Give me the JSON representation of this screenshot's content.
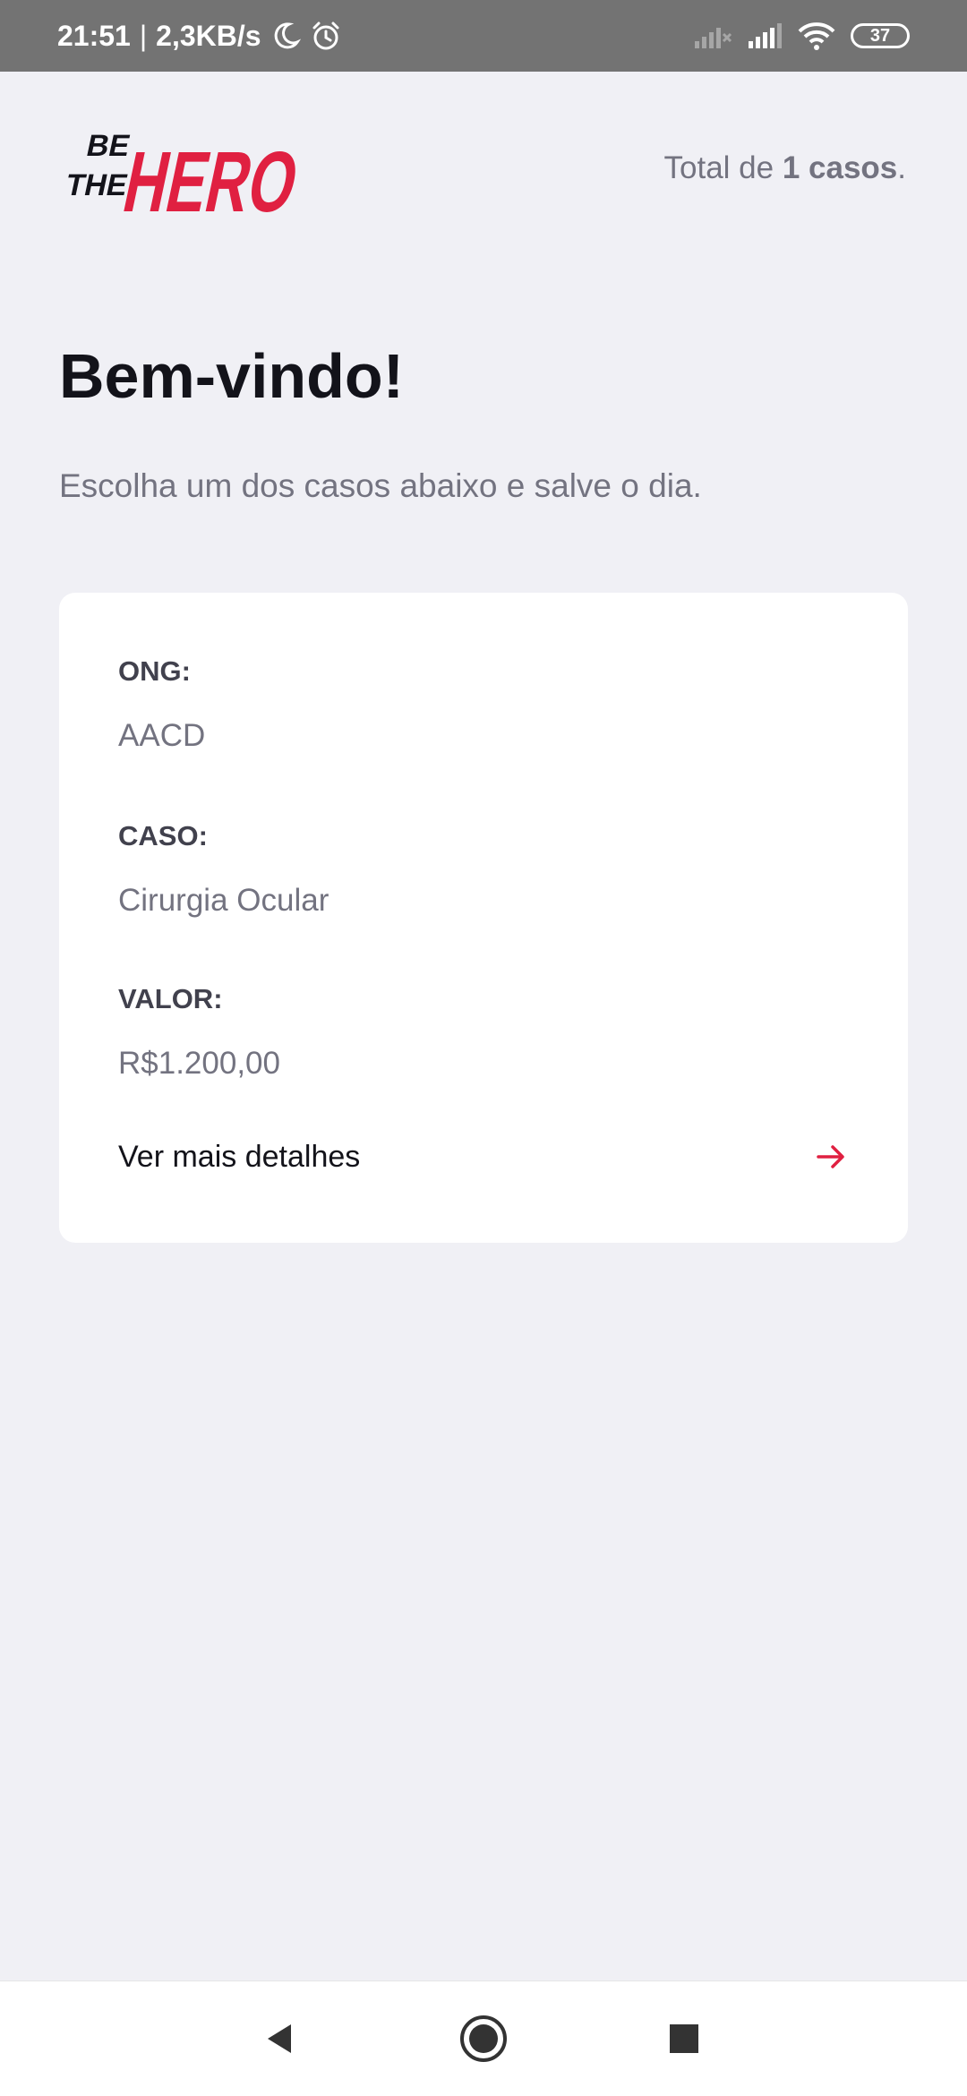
{
  "status_bar": {
    "time": "21:51",
    "separator": "|",
    "net_speed": "2,3KB/s",
    "battery": "37"
  },
  "header": {
    "logo_text": "BE THE HERO",
    "total_prefix": "Total de ",
    "total_count": "1 casos",
    "total_suffix": "."
  },
  "main": {
    "title": "Bem-vindo!",
    "subtitle": "Escolha um dos casos abaixo e salve o dia."
  },
  "incident": {
    "ong_label": "ONG:",
    "ong_value": "AACD",
    "case_label": "CASO:",
    "case_value": "Cirurgia Ocular",
    "value_label": "VALOR:",
    "value_value": "R$1.200,00",
    "details_label": "Ver mais detalhes"
  },
  "colors": {
    "brand": "#e02041",
    "background": "#f0f0f5",
    "title": "#13131a",
    "text_muted": "#737380"
  },
  "icons": {
    "details": "arrow-right-icon",
    "nav_back": "back-triangle-icon",
    "nav_home": "home-circle-icon",
    "nav_recents": "recents-square-icon"
  }
}
